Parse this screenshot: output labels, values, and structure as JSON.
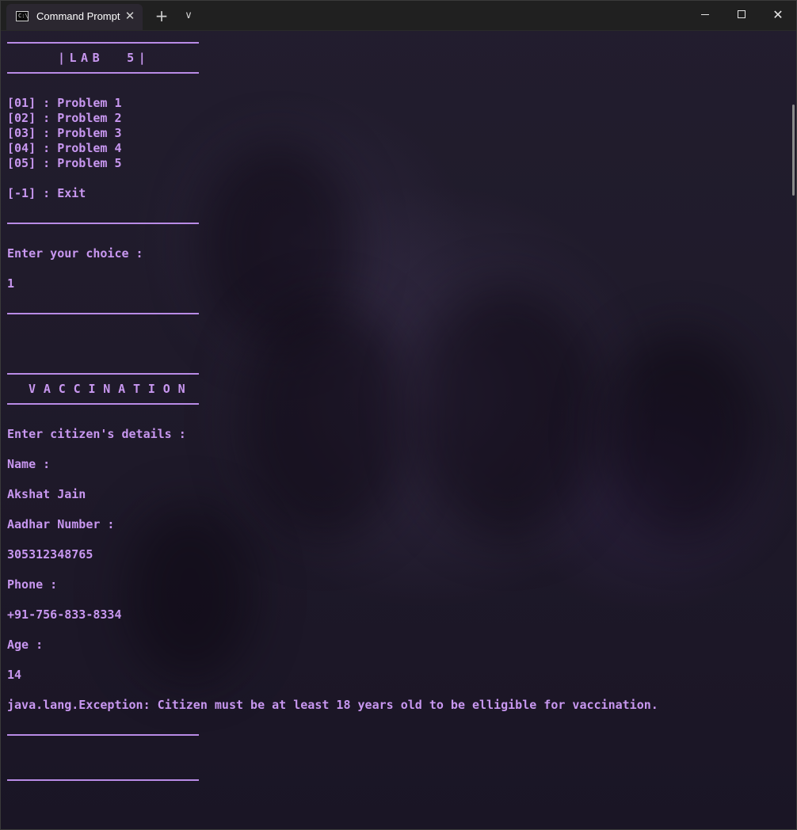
{
  "window": {
    "tab_title": "Command Prompt",
    "tab_icon": "terminal-icon",
    "new_tab_glyph": "+",
    "dropdown_glyph": "∨",
    "close_tab_glyph": "✕",
    "close_glyph": "✕"
  },
  "colors": {
    "text": "#c897f0",
    "rule": "#b98be6",
    "titlebar": "#202020"
  },
  "terminal": {
    "menu_title": "|LAB  5|",
    "menu_items": [
      "[01] : Problem 1",
      "[02] : Problem 2",
      "[03] : Problem 3",
      "[04] : Problem 4",
      "[05] : Problem 5"
    ],
    "exit_item": "[-1] : Exit",
    "choice_prompt": "Enter your choice :",
    "choice_value": "1",
    "section_title": "V A C C I N A T I O N",
    "details_prompt": "Enter citizen's details :",
    "name_label": "Name :",
    "name_value": "Akshat Jain",
    "aadhar_label": "Aadhar Number :",
    "aadhar_value": "305312348765",
    "phone_label": "Phone :",
    "phone_value": "+91-756-833-8334",
    "age_label": "Age :",
    "age_value": "14",
    "exception": "java.lang.Exception: Citizen must be at least 18 years old to be elligible for vaccination."
  }
}
